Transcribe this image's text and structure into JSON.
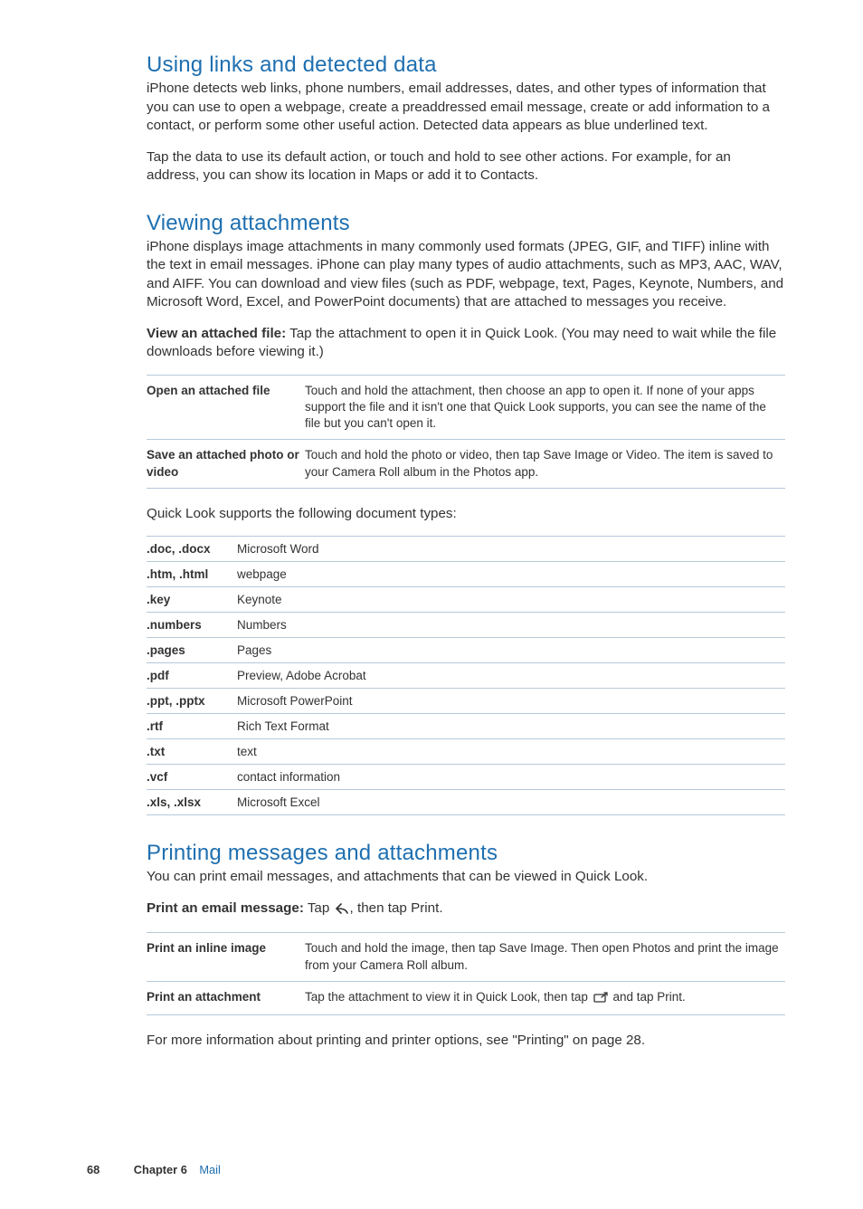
{
  "section1": {
    "heading": "Using links and detected data",
    "p1": "iPhone detects web links, phone numbers, email addresses, dates, and other types of information that you can use to open a webpage, create a preaddressed email message, create or add information to a contact, or perform some other useful action. Detected data appears as blue underlined text.",
    "p2": "Tap the data to use its default action, or touch and hold to see other actions. For example, for an address, you can show its location in Maps or add it to Contacts."
  },
  "section2": {
    "heading": "Viewing attachments",
    "p1": "iPhone displays image attachments in many commonly used formats (JPEG, GIF, and TIFF) inline with the text in email messages. iPhone can play many types of audio attachments, such as MP3, AAC, WAV, and AIFF. You can download and view files (such as PDF, webpage, text, Pages, Keynote, Numbers, and Microsoft Word, Excel, and PowerPoint documents) that are attached to messages you receive.",
    "view_bold": "View an attached file:",
    "view_rest": "  Tap the attachment to open it in Quick Look. (You may need to wait while the file downloads before viewing it.)",
    "table1": [
      {
        "label": "Open an attached file",
        "value": "Touch and hold the attachment, then choose an app to open it. If none of your apps support the file and it isn't one that Quick Look supports, you can see the name of the file but you can't open it."
      },
      {
        "label": "Save an attached photo or video",
        "value": "Touch and hold the photo or video, then tap Save Image or Video. The item is saved to your Camera Roll album in the Photos app."
      }
    ],
    "types_intro": "Quick Look supports the following document types:",
    "types": [
      {
        "ext": ".doc, .docx",
        "desc": "Microsoft Word"
      },
      {
        "ext": ".htm, .html",
        "desc": "webpage"
      },
      {
        "ext": ".key",
        "desc": "Keynote"
      },
      {
        "ext": ".numbers",
        "desc": "Numbers"
      },
      {
        "ext": ".pages",
        "desc": "Pages"
      },
      {
        "ext": ".pdf",
        "desc": "Preview, Adobe Acrobat"
      },
      {
        "ext": ".ppt, .pptx",
        "desc": "Microsoft PowerPoint"
      },
      {
        "ext": ".rtf",
        "desc": "Rich Text Format"
      },
      {
        "ext": ".txt",
        "desc": "text"
      },
      {
        "ext": ".vcf",
        "desc": "contact information"
      },
      {
        "ext": ".xls, .xlsx",
        "desc": "Microsoft Excel"
      }
    ]
  },
  "section3": {
    "heading": "Printing messages and attachments",
    "p1": "You can print email messages, and attachments that can be viewed in Quick Look.",
    "print_bold": "Print an email message:",
    "print_rest_a": "  Tap ",
    "print_rest_b": ", then tap Print.",
    "table3": [
      {
        "label": "Print an inline image",
        "value": "Touch and hold the image, then tap Save Image. Then open Photos and print the image from your Camera Roll album."
      },
      {
        "label": "Print an attachment",
        "value_a": "Tap the attachment to view it in Quick Look, then tap ",
        "value_b": " and tap Print."
      }
    ],
    "more": "For more information about printing and printer options, see \"Printing\" on page 28."
  },
  "footer": {
    "page": "68",
    "chapter_label": "Chapter 6",
    "chapter_name": "Mail"
  }
}
